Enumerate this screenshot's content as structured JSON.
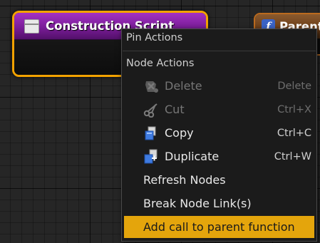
{
  "construction_node": {
    "title": "Construction Script"
  },
  "parent_node": {
    "title": "Parent",
    "icon_glyph": "f"
  },
  "context_menu": {
    "pin_actions_heading": "Pin Actions",
    "node_actions_heading": "Node Actions",
    "items": [
      {
        "label": "Delete",
        "shortcut": "Delete",
        "icon": "delete-icon",
        "enabled": false
      },
      {
        "label": "Cut",
        "shortcut": "Ctrl+X",
        "icon": "scissors-icon",
        "enabled": false
      },
      {
        "label": "Copy",
        "shortcut": "Ctrl+C",
        "icon": "copy-icon",
        "enabled": true
      },
      {
        "label": "Duplicate",
        "shortcut": "Ctrl+W",
        "icon": "duplicate-icon",
        "enabled": true
      },
      {
        "label": "Refresh Nodes",
        "shortcut": "",
        "icon": "",
        "enabled": true
      },
      {
        "label": "Break Node Link(s)",
        "shortcut": "",
        "icon": "",
        "enabled": true
      },
      {
        "label": "Add call to parent function",
        "shortcut": "",
        "icon": "",
        "enabled": true,
        "highlighted": true
      }
    ]
  },
  "colors": {
    "node_border": "#f2a200",
    "node_header": "#7a1d98",
    "highlight": "#e4a50c",
    "menu_background": "#1b1b1b"
  }
}
